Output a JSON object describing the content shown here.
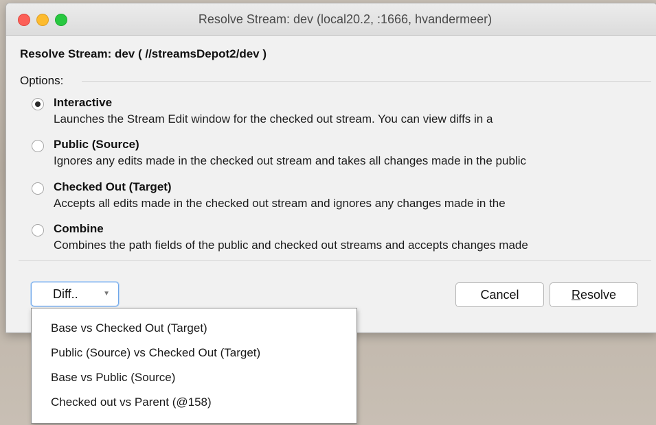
{
  "window": {
    "title": "Resolve Stream: dev (local20.2,  :1666,  hvandermeer)"
  },
  "dialog": {
    "heading": "Resolve Stream: dev ( //streamsDepot2/dev )",
    "options_label": "Options:",
    "options": [
      {
        "title": "Interactive",
        "description": "Launches the Stream Edit window for the checked out stream. You can view diffs in a",
        "selected": true
      },
      {
        "title": "Public (Source)",
        "description": "Ignores any edits made in the checked out stream and takes all changes made in the public",
        "selected": false
      },
      {
        "title": "Checked Out (Target)",
        "description": "Accepts all edits made in the checked out stream and ignores any changes made in the",
        "selected": false
      },
      {
        "title": "Combine",
        "description": "Combines the path fields of the public and checked out streams and accepts changes made",
        "selected": false
      }
    ]
  },
  "buttons": {
    "diff_label": "Diff..",
    "diff_arrow_icon": "chevron-down-icon",
    "cancel_label": "Cancel",
    "resolve_first": "R",
    "resolve_rest": "esolve"
  },
  "diff_menu": {
    "items": [
      "Base vs Checked Out (Target)",
      "Public (Source) vs Checked Out (Target)",
      "Base vs Public (Source)",
      "Checked out vs Parent (@158)"
    ]
  }
}
